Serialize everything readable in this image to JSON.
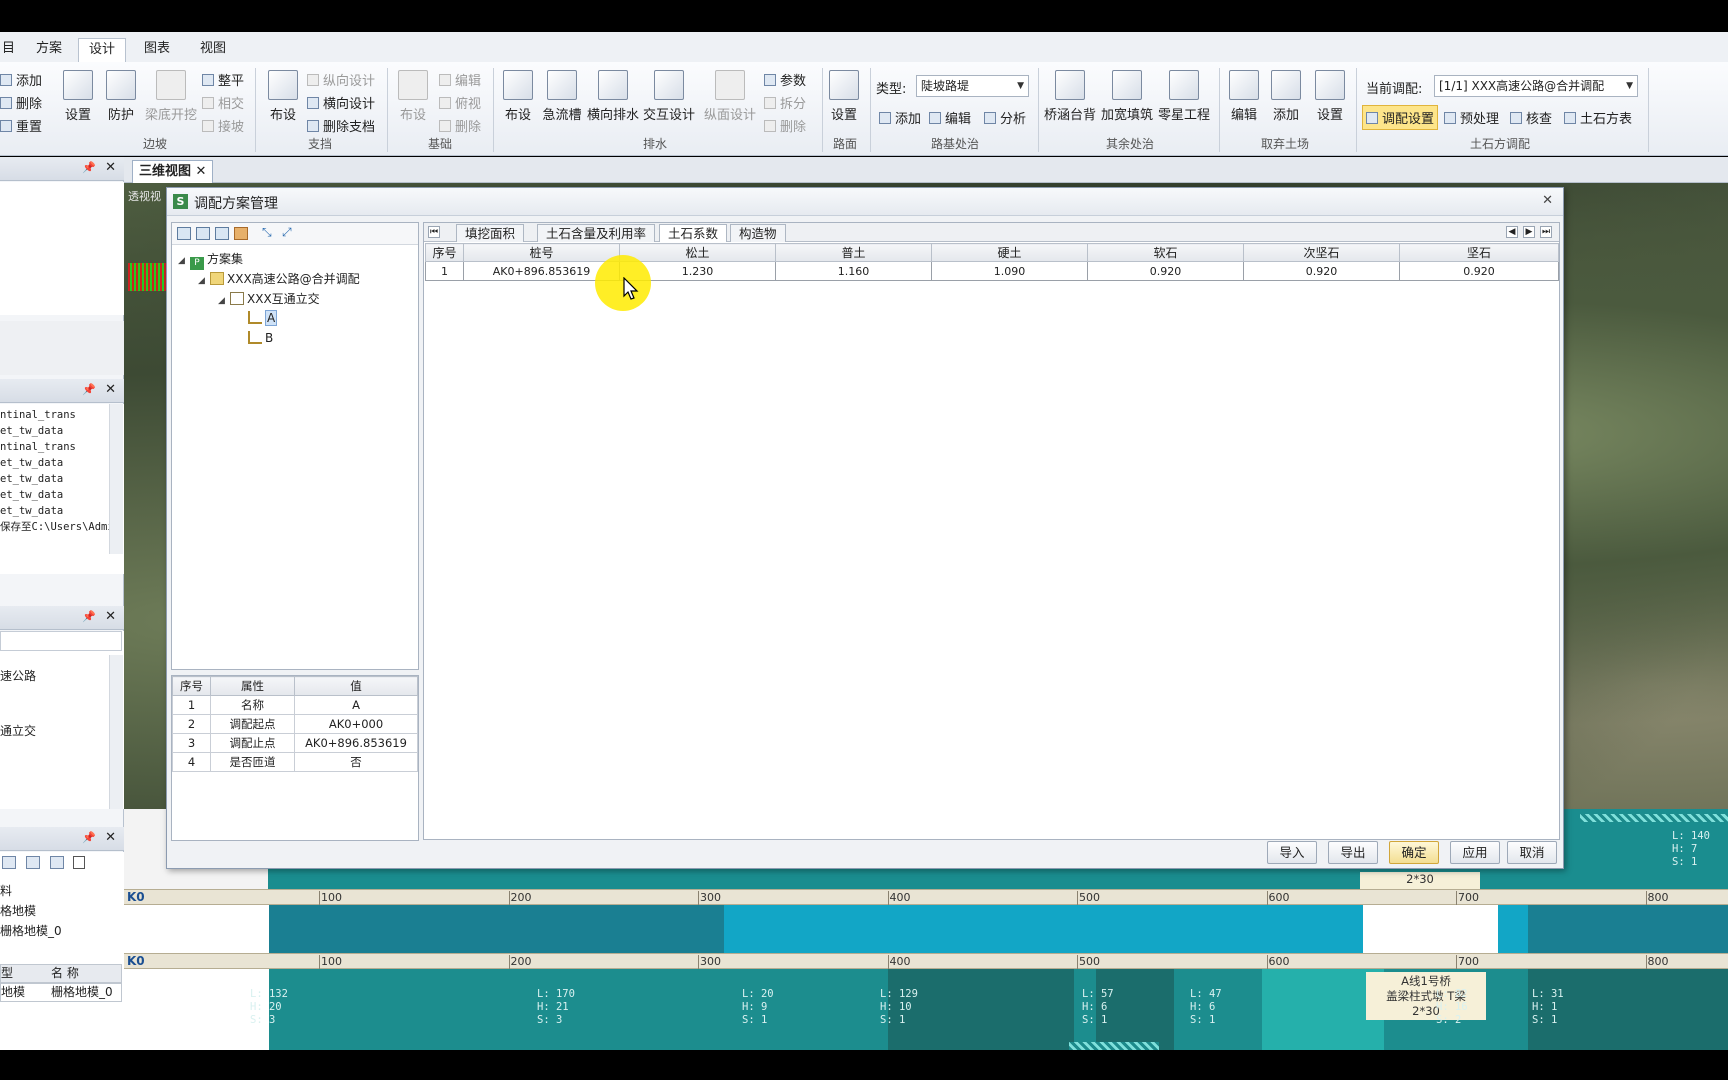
{
  "ribbon": {
    "tabs": [
      "目",
      "方案",
      "设计",
      "图表",
      "视图"
    ],
    "active_tab": "设计",
    "groups": {
      "slope": {
        "label": "边坡",
        "add": "添加",
        "delete": "删除",
        "reset": "重置",
        "settings": "设置",
        "protect": "防护",
        "beam": "梁底开挖",
        "level": "整平",
        "intersect": "相交",
        "connect": "接坡"
      },
      "support": {
        "label": "支挡",
        "layout": "布设",
        "long_design": "纵向设计",
        "trans_design": "横向设计",
        "del_wall": "删除支档"
      },
      "foundation": {
        "label": "基础",
        "layout": "布设",
        "edit": "编辑",
        "top_view": "俯视",
        "delete": "删除"
      },
      "drainage": {
        "label": "排水",
        "layout": "布设",
        "chute": "急流槽",
        "cross": "横向排水",
        "interactive": "交互设计",
        "long_face": "纵面设计",
        "params": "参数",
        "split": "拆分",
        "delete": "删除"
      },
      "pavement": {
        "label": "路面",
        "settings": "设置"
      },
      "subgrade": {
        "label": "路基处治",
        "type_label": "类型:",
        "type_value": "陡坡路堤",
        "add": "添加",
        "edit": "编辑",
        "analyze": "分析"
      },
      "other": {
        "label": "其余处治",
        "culvert": "桥涵台背",
        "widen": "加宽填筑",
        "misc": "零星工程"
      },
      "borrow": {
        "label": "取弃土场",
        "edit": "编辑",
        "add": "添加",
        "settings": "设置"
      },
      "earthwork": {
        "label": "土石方调配",
        "current_label": "当前调配:",
        "current_value": "[1/1] XXX高速公路@合并调配",
        "alloc_settings": "调配设置",
        "preprocess": "预处理",
        "check": "核查",
        "table": "土石方表"
      }
    }
  },
  "left_dock": {
    "log_lines": [
      "ntinal_trans",
      "et_tw_data",
      "ntinal_trans",
      "et_tw_data",
      "et_tw_data",
      "et_tw_data",
      "et_tw_data",
      "保存至C:\\Users\\Admi"
    ],
    "tree_lines": [
      "速公路",
      "通立交"
    ],
    "layer_lines": [
      "料",
      "格地模",
      "栅格地模_0"
    ],
    "list_headers": [
      "型",
      "名 称"
    ],
    "list_row": [
      "地模",
      "栅格地模_0"
    ]
  },
  "doc_tab": {
    "label": "三维视图",
    "view_label": "透视视"
  },
  "dialog": {
    "title": "调配方案管理",
    "tree": {
      "root": "方案集",
      "project": "XXX高速公路@合并调配",
      "interchange": "XXX互通立交",
      "schemes": [
        "A",
        "B"
      ],
      "selected": "A"
    },
    "properties": {
      "headers": [
        "序号",
        "属性",
        "值"
      ],
      "rows": [
        [
          "1",
          "名称",
          "A"
        ],
        [
          "2",
          "调配起点",
          "AK0+000"
        ],
        [
          "3",
          "调配止点",
          "AK0+896.853619"
        ],
        [
          "4",
          "是否匝道",
          "否"
        ]
      ]
    },
    "tabs": [
      "填挖面积",
      "土石含量及利用率",
      "土石系数",
      "构造物"
    ],
    "active_tab": "土石系数",
    "table": {
      "headers": [
        "序号",
        "桩号",
        "松土",
        "普土",
        "硬土",
        "软石",
        "次坚石",
        "坚石"
      ],
      "rows": [
        [
          "1",
          "AK0+896.853619",
          "1.230",
          "1.160",
          "1.090",
          "0.920",
          "0.920",
          "0.920"
        ]
      ]
    },
    "buttons": {
      "import": "导入",
      "export": "导出",
      "ok": "确定",
      "apply": "应用",
      "cancel": "取消"
    }
  },
  "profile": {
    "ruler_label": "K0",
    "ticks": [
      "100",
      "200",
      "300",
      "400",
      "500",
      "600",
      "700",
      "800"
    ],
    "top_right_label": "L: 140\nH: 7\nS: 1",
    "bridge_label_top": "2*30",
    "segments": [
      "L: 132\nH: 20\nS: 3",
      "L: 170\nH: 21\nS: 3",
      "L: 20\nH: 9\nS: 1",
      "L: 129\nH: 10\nS: 1",
      "L: 57\nH: 6\nS: 1",
      "L: 47\nH: 6\nS: 1",
      "L: 82\nH: 16\nS: 2",
      "L: 31\nH: 1\nS: 1"
    ],
    "bridge": {
      "name": "A线1号桥",
      "type": "盖梁柱式墩 T梁",
      "span": "2*30"
    }
  }
}
